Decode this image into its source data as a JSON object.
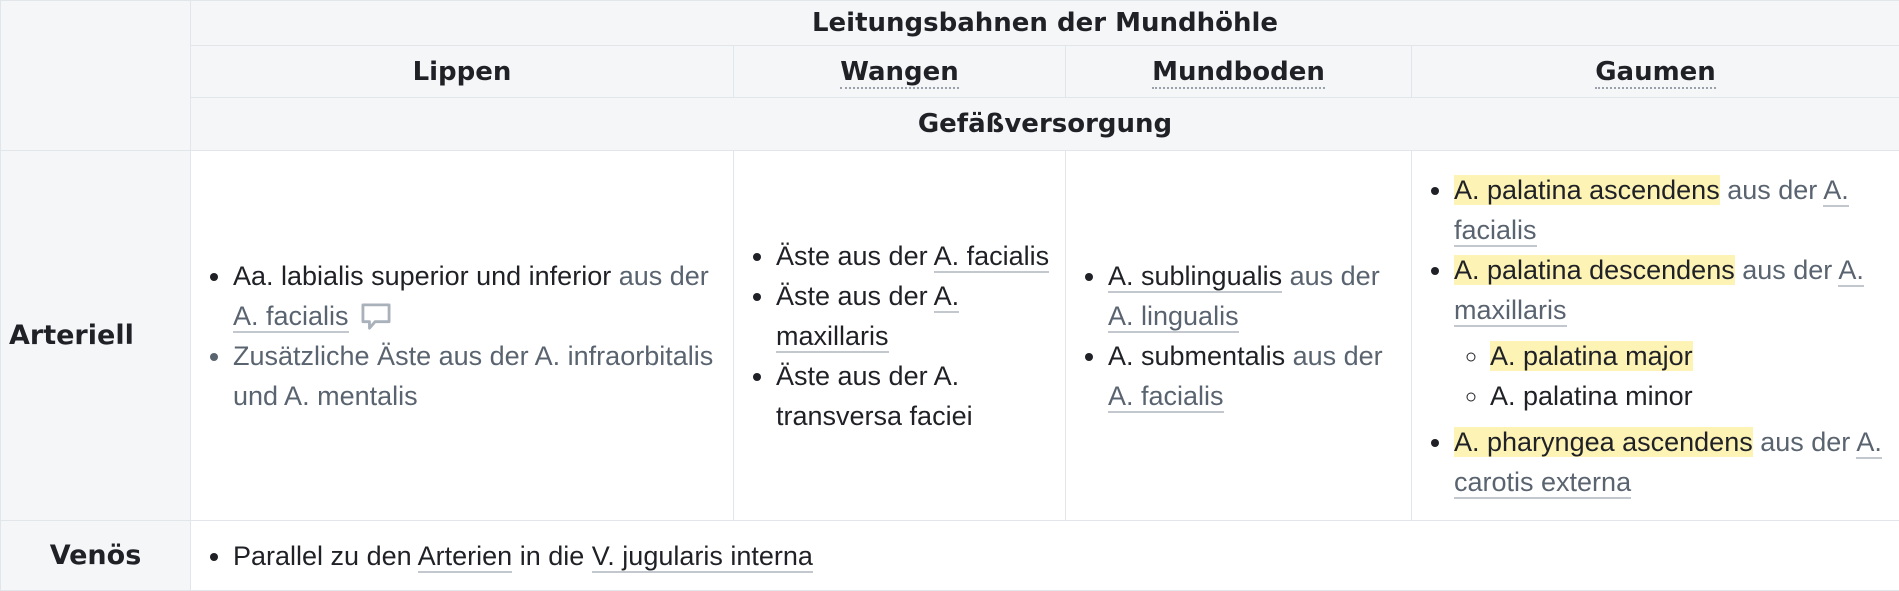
{
  "table": {
    "title": "Leitungsbahnen der Mundhöhle",
    "columns": [
      "Lippen",
      "Wangen",
      "Mundboden",
      "Gaumen"
    ],
    "section": "Gefäßversorgung",
    "rows": {
      "arteriell": {
        "label": "Arteriell",
        "lippen": [
          {
            "main": "Aa. labialis superior und inferior",
            "suffix": "aus der",
            "link": "A. facialis"
          },
          {
            "muted": "Zusätzliche Äste aus der A. infraorbitalis und A. mentalis"
          }
        ],
        "wangen": [
          {
            "text": "Äste aus der",
            "link": "A. facialis"
          },
          {
            "text": "Äste aus der",
            "link": "A. maxillaris"
          },
          {
            "text": "Äste aus der A. transversa faciei"
          }
        ],
        "mundboden": [
          {
            "link1": "A. sublingualis",
            "suffix": "aus der",
            "link2": "A. lingualis"
          },
          {
            "main": "A. submentalis",
            "suffix": "aus der",
            "link": "A. facialis"
          }
        ],
        "gaumen": [
          {
            "hl": "A. palatina ascendens",
            "suffix": "aus der",
            "link": "A. facialis"
          },
          {
            "hl": "A. palatina descendens",
            "suffix": "aus der",
            "link": "A. maxillaris",
            "sub": [
              {
                "hl": "A. palatina major"
              },
              {
                "text": "A. palatina minor"
              }
            ]
          },
          {
            "hl": "A. pharyngea ascendens",
            "suffix": "aus der",
            "link": "A. carotis externa"
          }
        ]
      },
      "venoes": {
        "label": "Venös",
        "item": {
          "pre": "Parallel zu den",
          "link1": "Arterien",
          "mid": "in die",
          "link2": "V. jugularis interna"
        }
      }
    }
  },
  "colors": {
    "header_bg": "#f5f6f8",
    "highlight": "#fcf3b5",
    "border": "#e2e5ea"
  }
}
